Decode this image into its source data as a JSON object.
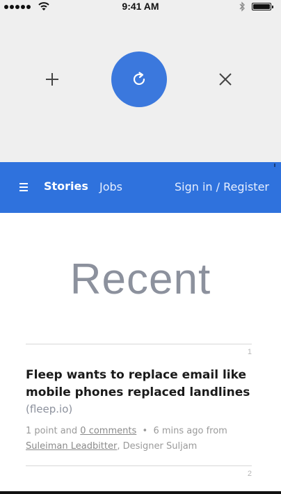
{
  "status_bar": {
    "time": "9:41 AM",
    "signal_icon": "signal-dots-icon",
    "wifi_icon": "wifi-icon",
    "bluetooth_icon": "bluetooth-icon",
    "battery_icon": "battery-icon",
    "battery_level": 1.0
  },
  "pull_controls": {
    "add_icon": "plus-icon",
    "refresh_icon": "refresh-icon",
    "close_icon": "close-icon",
    "accent_color": "#3b78dd"
  },
  "nav": {
    "menu_icon": "hamburger-icon",
    "stories_label": "Stories",
    "jobs_label": "Jobs",
    "signin_label": "Sign in / Register",
    "bar_color": "#2f72dd"
  },
  "main": {
    "heading": "Recent",
    "stories": [
      {
        "rank": "1",
        "title": "Fleep wants to replace email like mobile phones replaced landlines",
        "domain": "(fleep.io)",
        "points_text": "1 point and",
        "comments_text": "0 comments",
        "separator": "•",
        "age_text": "6 mins ago from",
        "author": "Suleiman Leadbitter",
        "author_suffix": ", Designer Suljam"
      },
      {
        "rank": "2"
      }
    ]
  }
}
